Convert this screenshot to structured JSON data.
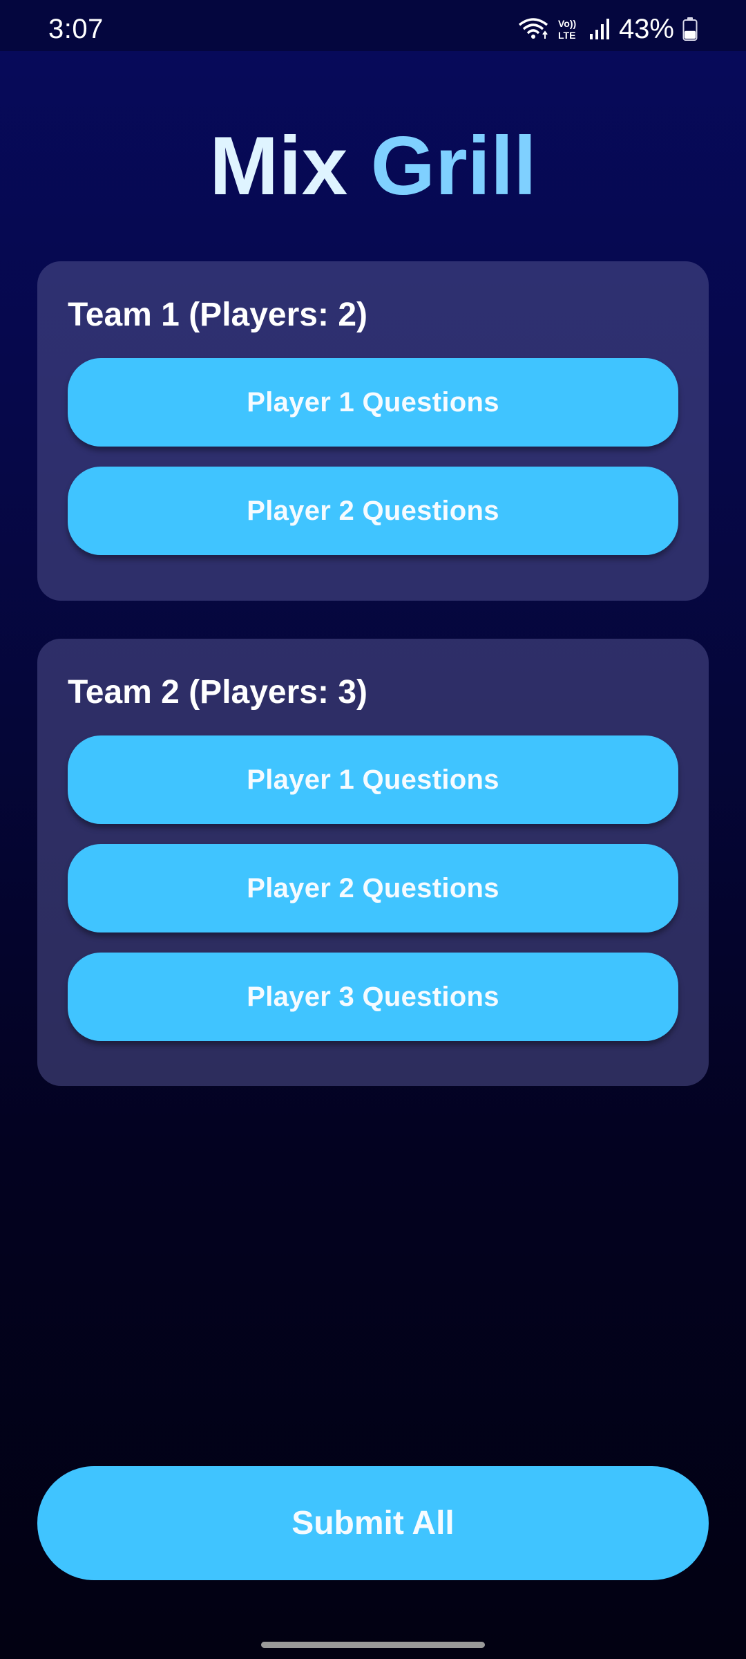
{
  "status_bar": {
    "time": "3:07",
    "battery_percent": "43%",
    "volte_label": "Vo)) LTE",
    "icons": [
      "wifi-icon",
      "volte-icon",
      "signal-icon",
      "battery-icon"
    ],
    "battery_level": 0.43
  },
  "title": {
    "word1": "Mix",
    "word2": "Grill",
    "word1_color": "#dff4ff",
    "word2_color": "#7fd0ff"
  },
  "teams": [
    {
      "heading": "Team 1 (Players: 2)",
      "players": [
        {
          "label": "Player 1 Questions"
        },
        {
          "label": "Player 2 Questions"
        }
      ]
    },
    {
      "heading": "Team 2 (Players: 3)",
      "players": [
        {
          "label": "Player 1 Questions"
        },
        {
          "label": "Player 2 Questions"
        },
        {
          "label": "Player 3 Questions"
        }
      ]
    }
  ],
  "submit": {
    "label": "Submit All"
  },
  "colors": {
    "accent": "#40c4ff",
    "card": "#3a3a6e",
    "background_top": "#070a5c",
    "background_bottom": "#020112"
  }
}
